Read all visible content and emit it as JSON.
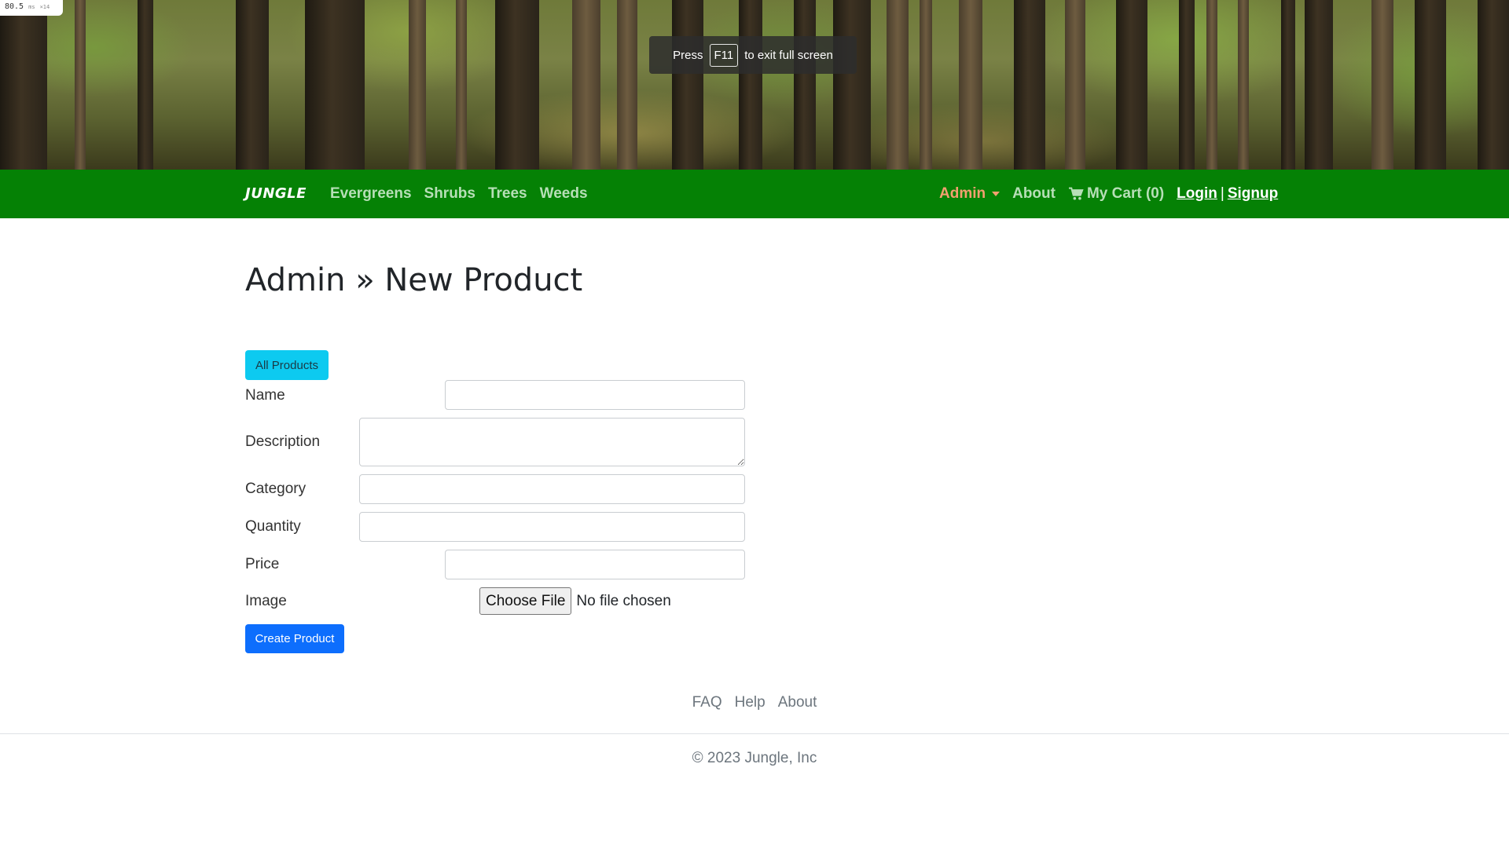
{
  "overlay": {
    "timing_value": "80.5",
    "timing_unit": "ms",
    "timing_count": "×14",
    "fullscreen_press": "Press",
    "fullscreen_key": "F11",
    "fullscreen_rest": "to exit full screen"
  },
  "nav": {
    "brand": "JUNGLE",
    "left_links": [
      "Evergreens",
      "Shrubs",
      "Trees",
      "Weeds"
    ],
    "admin": "Admin",
    "about": "About",
    "cart": "My Cart (0)",
    "login": "Login",
    "separator": "|",
    "signup": "Signup",
    "colors": {
      "navbar_bg": "#058105",
      "link": "#b7dfb7",
      "admin": "#f3a070"
    }
  },
  "main": {
    "title": "Admin » New Product",
    "all_products_button": "All Products",
    "form": {
      "name_label": "Name",
      "description_label": "Description",
      "category_label": "Category",
      "quantity_label": "Quantity",
      "price_label": "Price",
      "image_label": "Image",
      "name_value": "",
      "description_value": "",
      "category_value": "",
      "quantity_value": "",
      "price_value": "",
      "choose_file_label": "Choose File",
      "no_file_text": "No file chosen",
      "submit_label": "Create Product"
    }
  },
  "footer": {
    "links": [
      "FAQ",
      "Help",
      "About"
    ],
    "copyright": "© 2023 Jungle, Inc"
  }
}
